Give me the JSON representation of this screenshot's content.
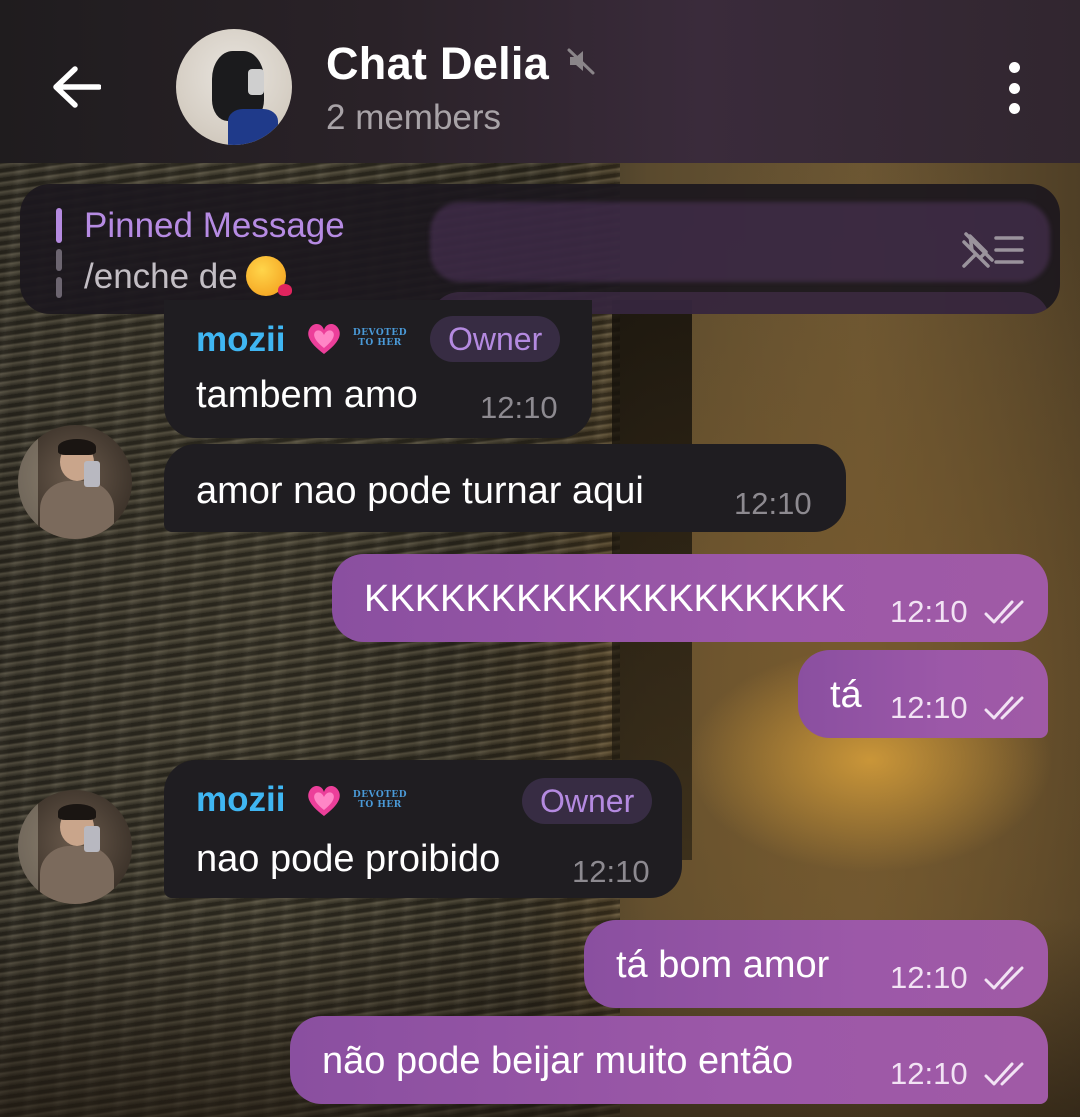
{
  "header": {
    "back_label": "back",
    "title": "Chat Delia",
    "subtitle": "2 members",
    "muted": true
  },
  "pinned": {
    "label": "Pinned Message",
    "text": "/enche de"
  },
  "messages": [
    {
      "direction": "in",
      "sender": "mozii",
      "badge": "DEVOTED TO HER",
      "role": "Owner",
      "text": "tambem amo",
      "time": "12:10"
    },
    {
      "direction": "in",
      "text": "amor nao pode turnar aqui",
      "time": "12:10"
    },
    {
      "direction": "out",
      "text": "KKKKKKKKKKKKKKKKKKK",
      "time": "12:10",
      "read": true
    },
    {
      "direction": "out",
      "text": "tá",
      "time": "12:10",
      "read": true
    },
    {
      "direction": "in",
      "sender": "mozii",
      "badge": "DEVOTED TO HER",
      "role": "Owner",
      "text": "nao pode proibido",
      "time": "12:10"
    },
    {
      "direction": "out",
      "text": "tá bom amor",
      "time": "12:10",
      "read": true
    },
    {
      "direction": "out",
      "text": "não pode beijar muito então",
      "time": "12:10",
      "read": true
    }
  ],
  "colors": {
    "sender": "#3fb6f2",
    "accent": "#b68be3",
    "outgoing_bubble": "#9c58a8",
    "incoming_bubble": "#1f1d21"
  },
  "icons": [
    "back-arrow-icon",
    "mute-icon",
    "more-vertical-icon",
    "pin-list-icon",
    "kiss-emoji-icon",
    "heart-emoji-icon",
    "double-check-icon"
  ]
}
